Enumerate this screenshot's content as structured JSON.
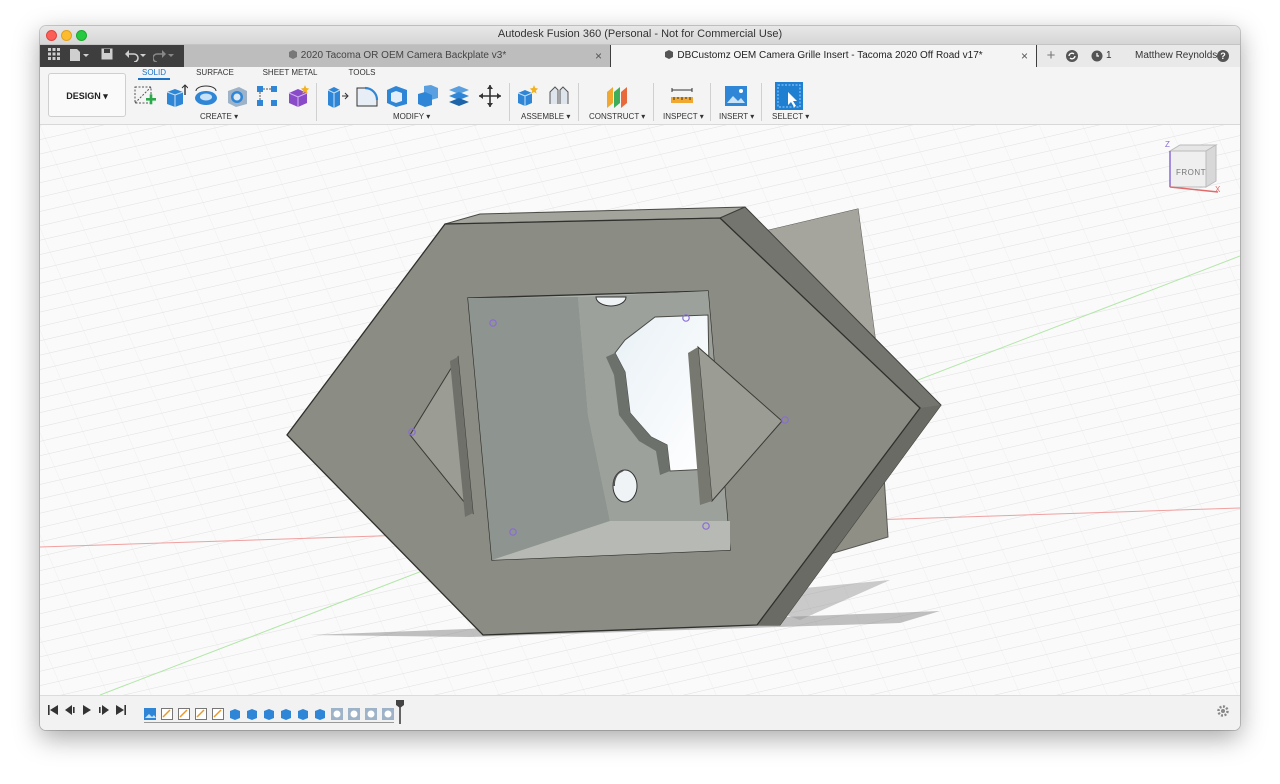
{
  "window": {
    "title": "Autodesk Fusion 360 (Personal - Not for Commercial Use)"
  },
  "tabs": [
    {
      "label": "2020 Tacoma OR OEM Camera Backplate v3*",
      "active": false
    },
    {
      "label": "DBCustomz OEM Camera Grille Insert - Tacoma 2020 Off Road v17*",
      "active": true
    }
  ],
  "header_right": {
    "jobs_count": "1",
    "user_name": "Matthew Reynolds",
    "help_label": "?"
  },
  "toolbar": {
    "workspace_label": "DESIGN ▾",
    "workspace_tabs": [
      {
        "label": "SOLID",
        "active": true
      },
      {
        "label": "SURFACE",
        "active": false
      },
      {
        "label": "SHEET METAL",
        "active": false
      },
      {
        "label": "TOOLS",
        "active": false
      }
    ],
    "groups": {
      "create": "CREATE ▾",
      "modify": "MODIFY ▾",
      "assemble": "ASSEMBLE ▾",
      "construct": "CONSTRUCT ▾",
      "inspect": "INSPECT ▾",
      "insert": "INSERT ▾",
      "select": "SELECT ▾"
    }
  },
  "viewcube": {
    "face_label": "FRONT",
    "axis_z": "Z",
    "axis_x": "X"
  },
  "icons": {
    "apps": "grid-icon",
    "file": "file-icon",
    "save": "save-icon",
    "undo": "undo-icon",
    "redo": "redo-icon",
    "add_tab": "plus-icon",
    "extensions": "refresh-icon",
    "jobs": "clock-icon",
    "help": "help-icon",
    "settings": "gear-icon"
  },
  "colors": {
    "accent": "#1a73c7",
    "model_face": "#8b8c84",
    "model_dark": "#6a6b64"
  }
}
